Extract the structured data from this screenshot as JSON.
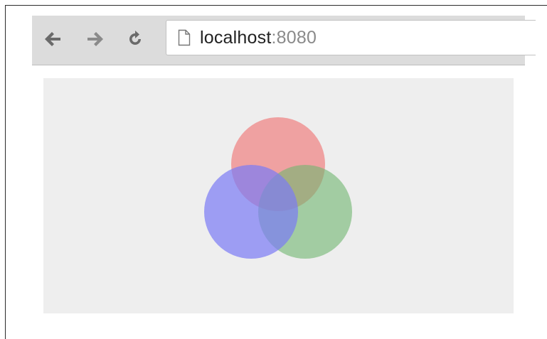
{
  "browser": {
    "back_icon": "back-arrow-icon",
    "forward_icon": "forward-arrow-icon",
    "reload_icon": "reload-icon",
    "page_icon": "blank-page-icon",
    "url_host": "localhost",
    "url_port": ":8080"
  },
  "venn": {
    "circles": [
      {
        "name": "red",
        "color": "#f08080",
        "opacity": 0.7
      },
      {
        "name": "blue",
        "color": "#7b7bf5",
        "opacity": 0.7
      },
      {
        "name": "green",
        "color": "#6fb56f",
        "opacity": 0.6
      }
    ]
  },
  "colors": {
    "toolbar": "#dcdcdc",
    "canvas_bg": "#eeeeee"
  }
}
